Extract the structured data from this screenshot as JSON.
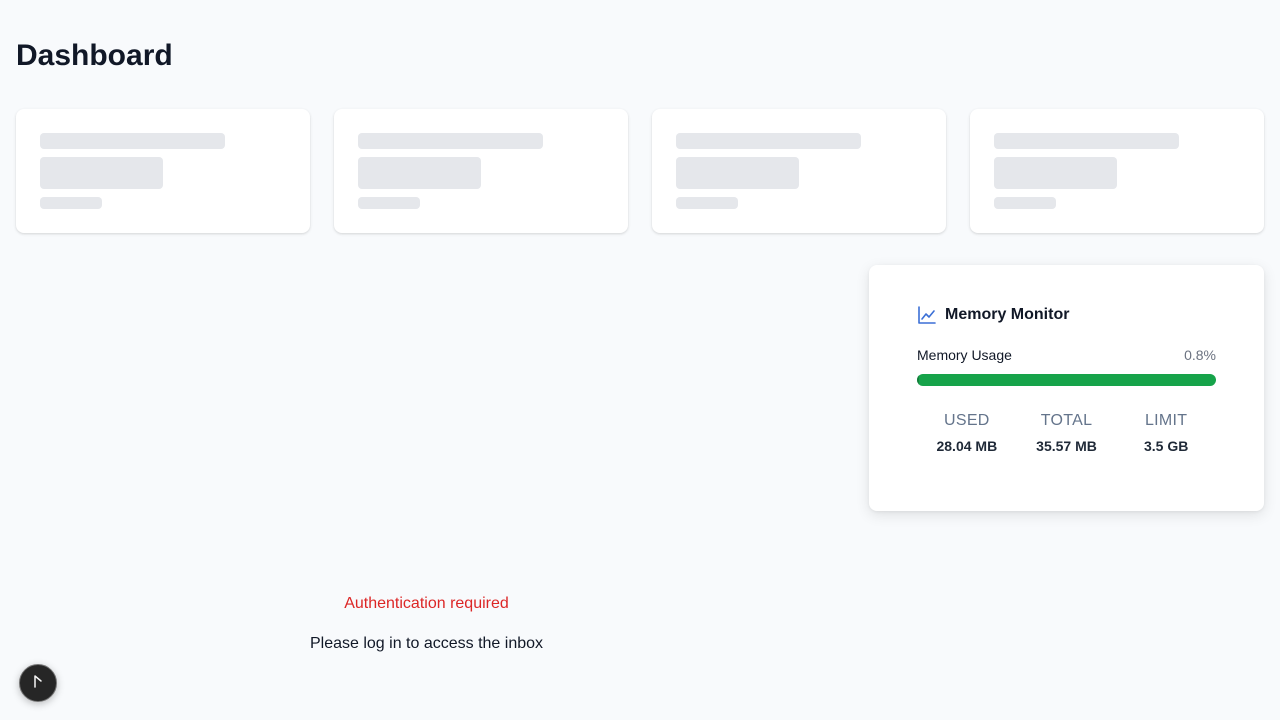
{
  "page": {
    "title": "Dashboard"
  },
  "stat_cards": [
    {
      "state": "loading"
    },
    {
      "state": "loading"
    },
    {
      "state": "loading"
    },
    {
      "state": "loading"
    }
  ],
  "memory_monitor": {
    "icon": "line-chart-icon",
    "title": "Memory Monitor",
    "usage_label": "Memory Usage",
    "usage_percent_text": "0.8%",
    "usage_fraction": 0.008,
    "bar_color": "#16a34a",
    "stats": [
      {
        "label": "USED",
        "value": "28.04 MB"
      },
      {
        "label": "TOTAL",
        "value": "35.57 MB"
      },
      {
        "label": "LIMIT",
        "value": "3.5 GB"
      }
    ]
  },
  "auth": {
    "error": "Authentication required",
    "message": "Please log in to access the inbox",
    "error_color": "#dc2626"
  },
  "floating_button": {
    "icon": "cursor-icon"
  }
}
